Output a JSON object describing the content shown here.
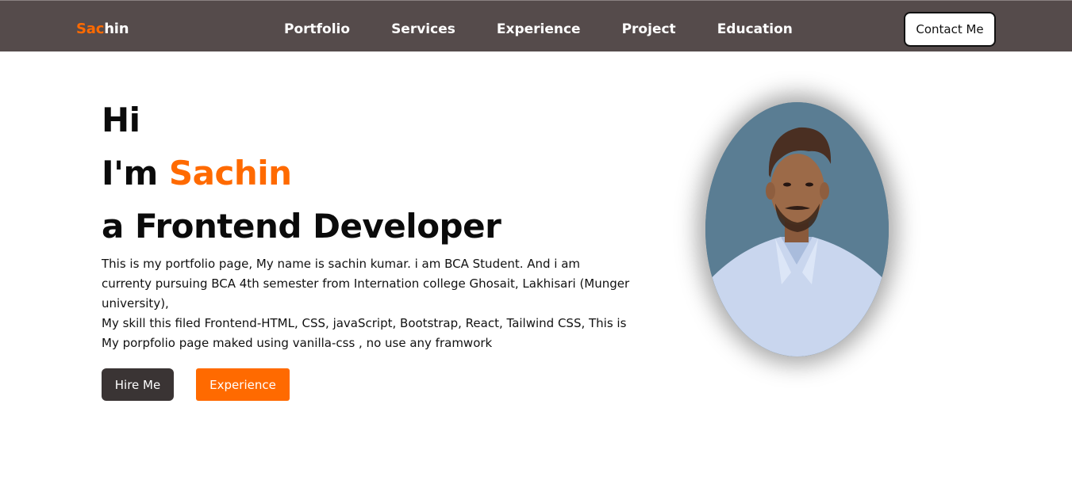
{
  "brand": {
    "accent_part": "Sac",
    "rest_part": "hin",
    "accent_color": "#ff6a00",
    "nav_bg": "#554b4b"
  },
  "nav": {
    "links": [
      "Portfolio",
      "Services",
      "Experience",
      "Project",
      "Education"
    ],
    "contact_label": "Contact Me"
  },
  "hero": {
    "greeting": "Hi",
    "intro_prefix": "I'm ",
    "name": "Sachin",
    "role": "a Frontend Developer",
    "paragraph_1": "This is my portfolio page, My name is sachin kumar. i am BCA Student. And i am currenty pursuing BCA 4th semester from Internation college Ghosait, Lakhisari (Munger university),",
    "paragraph_2": "My skill this filed Frontend-HTML, CSS, javaScript, Bootstrap, React, Tailwind CSS, This is My porpfolio page maked using vanilla-css , no use any framwork"
  },
  "buttons": {
    "hire_label": "Hire Me",
    "experience_label": "Experience"
  },
  "profile": {
    "icon": "profile-photo",
    "bg_color": "#5a7d93",
    "shirt_color": "#c9d6ee"
  }
}
